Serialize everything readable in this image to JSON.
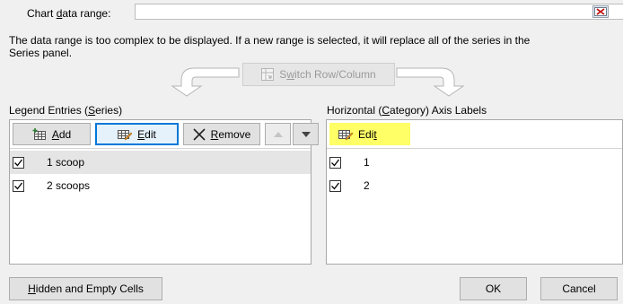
{
  "chart_range": {
    "label_pre": "Chart ",
    "label_key": "d",
    "label_post": "ata range:",
    "value": ""
  },
  "message": "The data range is too complex to be displayed. If a new range is selected, it will replace all of the series in the\nSeries panel.",
  "switch": {
    "pre": "S",
    "key": "w",
    "post": "itch Row/Column",
    "enabled": false
  },
  "legend": {
    "title_pre": "Legend Entries (",
    "title_key": "S",
    "title_post": "eries)",
    "add_key": "A",
    "add_post": "dd",
    "edit_key": "E",
    "edit_post": "dit",
    "remove_key": "R",
    "remove_post": "emove",
    "items": [
      {
        "label": "1 scoop",
        "checked": true,
        "selected": true
      },
      {
        "label": "2 scoops",
        "checked": true,
        "selected": false
      }
    ]
  },
  "axis": {
    "title_pre": "Horizontal (",
    "title_key": "C",
    "title_post": "ategory) Axis Labels",
    "edit_pre": "Edi",
    "edit_key": "t",
    "items": [
      {
        "label": "1",
        "checked": true
      },
      {
        "label": "2",
        "checked": true
      }
    ]
  },
  "bottom": {
    "hidden_key": "H",
    "hidden_post": "idden and Empty Cells",
    "ok": "OK",
    "cancel": "Cancel"
  },
  "colors": {
    "focus_border": "#0078d7",
    "highlight": "#ffff66"
  }
}
